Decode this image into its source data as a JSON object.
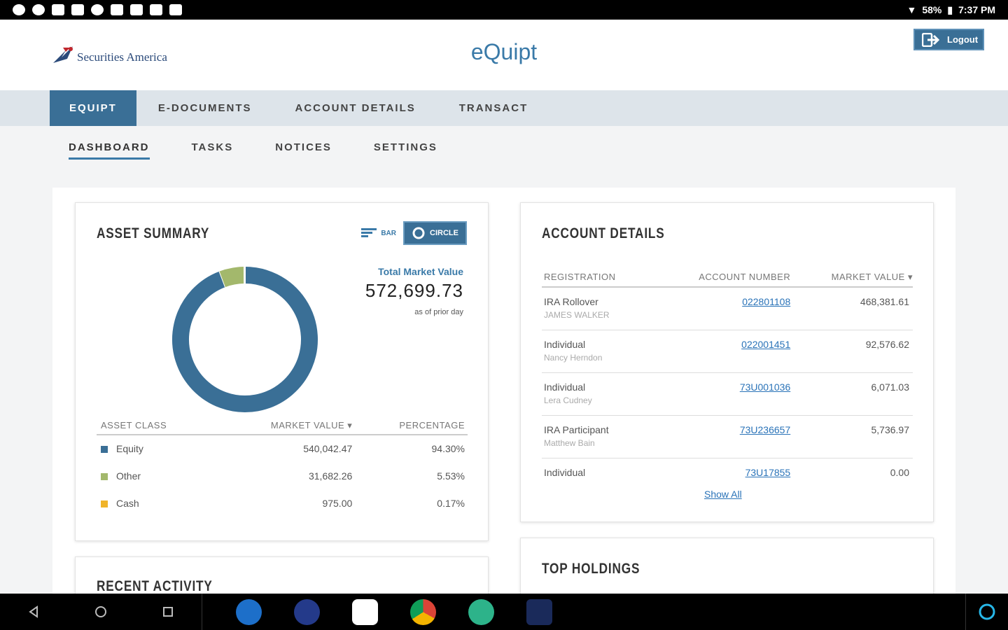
{
  "status_bar": {
    "battery": "58%",
    "time": "7:37 PM"
  },
  "header": {
    "brand": "Securities America",
    "app_title": "eQuipt",
    "logout_label": "Logout"
  },
  "nav": {
    "items": [
      {
        "label": "EQUIPT",
        "active": true
      },
      {
        "label": "E-DOCUMENTS"
      },
      {
        "label": "ACCOUNT DETAILS"
      },
      {
        "label": "TRANSACT"
      }
    ]
  },
  "subnav": {
    "items": [
      {
        "label": "DASHBOARD",
        "active": true
      },
      {
        "label": "TASKS"
      },
      {
        "label": "NOTICES"
      },
      {
        "label": "SETTINGS"
      }
    ]
  },
  "asset_summary": {
    "title": "ASSET SUMMARY",
    "toggle_bar": "BAR",
    "toggle_circle": "CIRCLE",
    "total_label": "Total Market Value",
    "total_value": "572,699.73",
    "total_note": "as of prior day",
    "columns": [
      "ASSET CLASS",
      "MARKET VALUE ▾",
      "PERCENTAGE"
    ],
    "rows": [
      {
        "class": "Equity",
        "value": "540,042.47",
        "pct": "94.30%",
        "color": "#3a6f96"
      },
      {
        "class": "Other",
        "value": "31,682.26",
        "pct": "5.53%",
        "color": "#a3b86c"
      },
      {
        "class": "Cash",
        "value": "975.00",
        "pct": "0.17%",
        "color": "#f0b429"
      }
    ]
  },
  "chart_data": {
    "type": "pie",
    "categories": [
      "Equity",
      "Other",
      "Cash"
    ],
    "values": [
      94.3,
      5.53,
      0.17
    ],
    "colors": [
      "#3a6f96",
      "#a3b86c",
      "#f0b429"
    ]
  },
  "recent_activity": {
    "title": "RECENT ACTIVITY"
  },
  "account_details": {
    "title": "ACCOUNT DETAILS",
    "columns": [
      "REGISTRATION",
      "ACCOUNT NUMBER",
      "MARKET VALUE ▾"
    ],
    "rows": [
      {
        "registration": "IRA Rollover",
        "owner": "JAMES WALKER",
        "account": "022801108",
        "value": "468,381.61"
      },
      {
        "registration": "Individual",
        "owner": "Nancy Herndon",
        "account": "022001451",
        "value": "92,576.62"
      },
      {
        "registration": "Individual",
        "owner": "Lera Cudney",
        "account": "73U001036",
        "value": "6,071.03"
      },
      {
        "registration": "IRA Participant",
        "owner": "Matthew Bain",
        "account": "73U236657",
        "value": "5,736.97"
      },
      {
        "registration": "Individual",
        "owner": "",
        "account": "73U17855",
        "value": "0.00"
      }
    ],
    "show_all": "Show All"
  },
  "top_holdings": {
    "title": "TOP HOLDINGS"
  }
}
